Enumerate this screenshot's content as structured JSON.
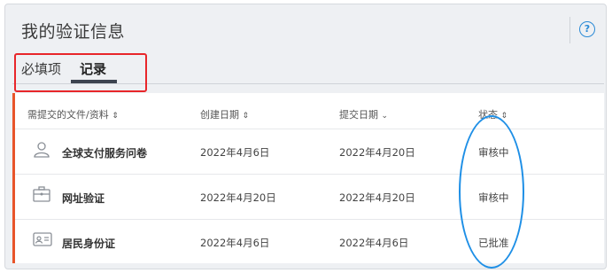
{
  "page": {
    "title": "我的验证信息",
    "help_icon": "question-circle-icon",
    "help_glyph": "?"
  },
  "tabs": [
    {
      "label": "必填项",
      "active": false
    },
    {
      "label": "记录",
      "active": true
    }
  ],
  "table": {
    "headers": [
      {
        "label": "需提交的文件/资料",
        "sort": "⌃⌄"
      },
      {
        "label": "创建日期",
        "sort": "⌃⌄"
      },
      {
        "label": "提交日期",
        "sort": "⌄"
      },
      {
        "label": "状态",
        "sort": "⌃⌄"
      }
    ],
    "rows": [
      {
        "icon": "user-icon",
        "name": "全球支付服务问卷",
        "created": "2022年4月6日",
        "submitted": "2022年4月20日",
        "status": "审核中"
      },
      {
        "icon": "briefcase-icon",
        "name": "网址验证",
        "created": "2022年4月20日",
        "submitted": "2022年4月20日",
        "status": "审核中"
      },
      {
        "icon": "id-card-icon",
        "name": "居民身份证",
        "created": "2022年4月6日",
        "submitted": "2022年4月6日",
        "status": "已批准"
      }
    ]
  },
  "colors": {
    "accent_bar": "#e8552a",
    "highlight_box": "#e8262a",
    "ellipse": "#1e8fe6",
    "help": "#2a8ad6"
  }
}
